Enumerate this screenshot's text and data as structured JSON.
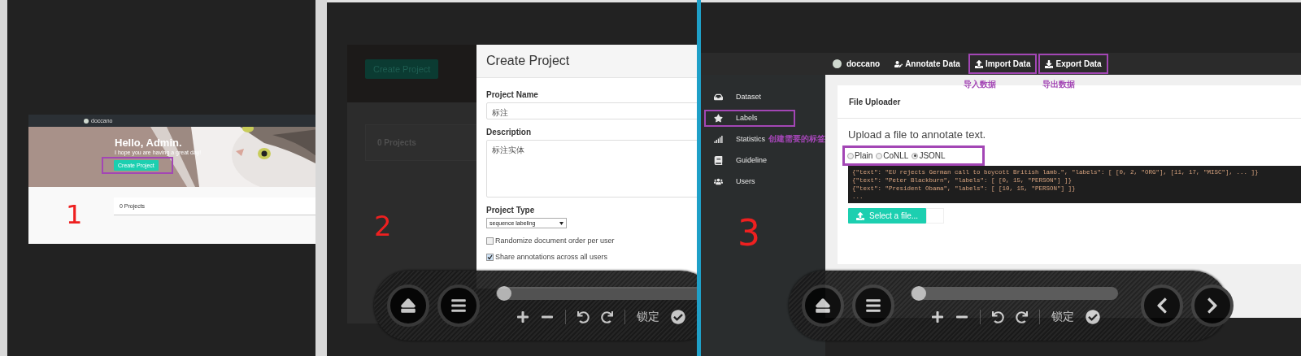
{
  "screenshot_1": {
    "brand": "doccano",
    "hero_title": "Hello, Admin.",
    "hero_subtitle": "I hope you are having a great day!",
    "create_button": {
      "label": "Create Project",
      "highlighted": true
    },
    "projects_count": "0 Projects",
    "step_mark": "1"
  },
  "screenshot_2": {
    "background": {
      "create_button": "Create Project",
      "projects_count": "0 Projects"
    },
    "dialog": {
      "title": "Create Project",
      "fields": [
        {
          "label": "Project Name",
          "value": "标注",
          "kind": "input"
        },
        {
          "label": "Description",
          "value": "标注实体",
          "kind": "textarea"
        }
      ],
      "type_label": "Project Type",
      "type_value": "sequence labeling",
      "options": [
        {
          "label": "Randomize document order per user",
          "checked": false
        },
        {
          "label": "Share annotations across all users",
          "checked": true
        }
      ]
    },
    "step_mark": "2"
  },
  "screenshot_3": {
    "navbar": {
      "brand": "doccano",
      "items": [
        {
          "label": "Annotate Data",
          "kind": "annotate",
          "highlighted": false
        },
        {
          "label": "Import Data",
          "kind": "import",
          "highlighted": true,
          "note": "导入数据"
        },
        {
          "label": "Export Data",
          "kind": "export",
          "highlighted": true,
          "note": "导出数据"
        }
      ]
    },
    "sidebar": [
      {
        "label": "Dataset",
        "kind": "dataset",
        "highlighted": false
      },
      {
        "label": "Labels",
        "kind": "labels",
        "highlighted": true
      },
      {
        "label": "Statistics",
        "kind": "statistics",
        "highlighted": false,
        "note": "创建需要的标签"
      },
      {
        "label": "Guideline",
        "kind": "guideline",
        "highlighted": false
      },
      {
        "label": "Users",
        "kind": "users",
        "highlighted": false
      }
    ],
    "uploader": {
      "title": "File Uploader",
      "prompt": "Upload a file to annotate text.",
      "formats_highlighted": true,
      "formats": [
        {
          "label": "Plain",
          "selected": false
        },
        {
          "label": "CoNLL",
          "selected": false
        },
        {
          "label": "JSONL",
          "selected": true
        }
      ],
      "example_lines": [
        "{\"text\": \"EU rejects German call to boycott British lamb.\", \"labels\": [ [0, 2, \"ORG\"], [11, 17, \"MISC\"], ... ]}",
        "{\"text\": \"Peter Blackburn\", \"labels\": [ [0, 15, \"PERSON\"] ]}",
        "{\"text\": \"President Obama\", \"labels\": [ [10, 15, \"PERSON\"] ]}",
        "..."
      ],
      "select_button": "Select a file..."
    },
    "step_mark": "3"
  },
  "viewer_toolbars": [
    {
      "level": 0.04,
      "lock_label": "锁定",
      "nav_arrows": false
    },
    {
      "level": 0.04,
      "lock_label": "锁定",
      "nav_arrows": true
    }
  ]
}
